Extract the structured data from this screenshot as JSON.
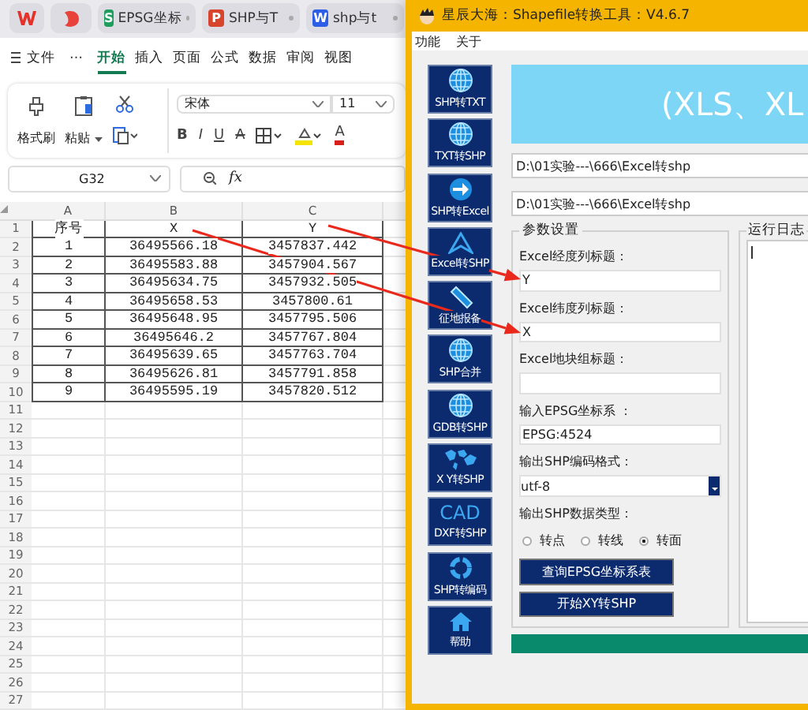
{
  "spreadsheet": {
    "tabs": [
      {
        "kind": "app-logo"
      },
      {
        "kind": "doc-logo"
      },
      {
        "kind": "doc",
        "badge": "S",
        "color": "#1f9d5c",
        "label": "EPSG坐标"
      },
      {
        "kind": "doc",
        "badge": "P",
        "color": "#d8452d",
        "label": "SHP与T"
      },
      {
        "kind": "doc",
        "badge": "W",
        "color": "#2c5fe6",
        "label": "shp与t"
      }
    ],
    "file_menu": "文件",
    "more": "⋯",
    "menu": [
      {
        "label": "开始",
        "selected": true
      },
      {
        "label": "插入",
        "selected": false
      },
      {
        "label": "页面",
        "selected": false
      },
      {
        "label": "公式",
        "selected": false
      },
      {
        "label": "数据",
        "selected": false
      },
      {
        "label": "审阅",
        "selected": false
      },
      {
        "label": "视图",
        "selected": false
      }
    ],
    "clipboard": {
      "format_painter": "格式刷",
      "paste": "粘贴"
    },
    "font": {
      "name": "宋体",
      "size": "11"
    },
    "format_buttons": [
      {
        "kind": "bold",
        "glyph": "B"
      },
      {
        "kind": "italic",
        "glyph": "I"
      },
      {
        "kind": "underline",
        "glyph": "U"
      },
      {
        "kind": "strike",
        "glyph": "A"
      },
      {
        "kind": "borders"
      },
      {
        "kind": "highlight"
      },
      {
        "kind": "font-color",
        "glyph": "A"
      }
    ],
    "name_box": "G32",
    "formula_label": "fx",
    "columns": [
      "A",
      "B",
      "C"
    ],
    "row_numbers": [
      "1",
      "2",
      "3",
      "4",
      "5",
      "6",
      "7",
      "8",
      "9",
      "10",
      "11",
      "12",
      "13",
      "14",
      "15",
      "16",
      "17",
      "18",
      "19",
      "20",
      "21",
      "22",
      "23",
      "24",
      "25",
      "26",
      "27"
    ],
    "rows": [
      [
        "序号",
        "X",
        "Y"
      ],
      [
        "1",
        "36495566.18",
        "3457837.442"
      ],
      [
        "2",
        "36495583.88",
        "3457904.567"
      ],
      [
        "3",
        "36495634.75",
        "3457932.505"
      ],
      [
        "4",
        "36495658.53",
        "3457800.61"
      ],
      [
        "5",
        "36495648.95",
        "3457795.506"
      ],
      [
        "6",
        "36495646.2",
        "3457767.804"
      ],
      [
        "7",
        "36495639.65",
        "3457763.704"
      ],
      [
        "8",
        "36495626.81",
        "3457791.858"
      ],
      [
        "9",
        "36495595.19",
        "3457820.512"
      ]
    ]
  },
  "tool": {
    "title": "星辰大海：Shapefile转换工具：V4.6.7",
    "menu": [
      "功能",
      "关于"
    ],
    "nav": [
      {
        "label": "SHP转TXT"
      },
      {
        "label": "TXT转SHP"
      },
      {
        "label": "SHP转Excel"
      },
      {
        "label": "Excel转SHP"
      },
      {
        "label": "征地报备"
      },
      {
        "label": "SHP合并"
      },
      {
        "label": "GDB转SHP"
      },
      {
        "label": "X Y转SHP"
      },
      {
        "top": "CAD",
        "label": "DXF转SHP"
      },
      {
        "label": "SHP转编码"
      },
      {
        "label": "帮助"
      }
    ],
    "banner": "(XLS、XL",
    "paths": [
      "D:\\01实验---\\666\\Excel转shp",
      "D:\\01实验---\\666\\Excel转shp"
    ],
    "settings": {
      "title": "参数设置",
      "fields": [
        {
          "label": "Excel经度列标题：",
          "value": "Y"
        },
        {
          "label": "Excel纬度列标题：",
          "value": "X"
        },
        {
          "label": "Excel地块组标题："
        },
        {
          "label": "输入EPSG坐标系 ：",
          "value": "EPSG:4524"
        }
      ],
      "encoding": {
        "label": "输出SHP编码格式：",
        "value": "utf-8"
      },
      "geometry": {
        "label": "输出SHP数据类型：",
        "options": [
          {
            "label": "转点",
            "selected": false
          },
          {
            "label": "转线",
            "selected": false
          },
          {
            "label": "转面",
            "selected": true
          }
        ]
      },
      "buttons": [
        "查询EPSG坐标系表",
        "开始XY转SHP"
      ]
    },
    "log": {
      "title": "运行日志"
    },
    "progress": {
      "level": 1
    }
  }
}
